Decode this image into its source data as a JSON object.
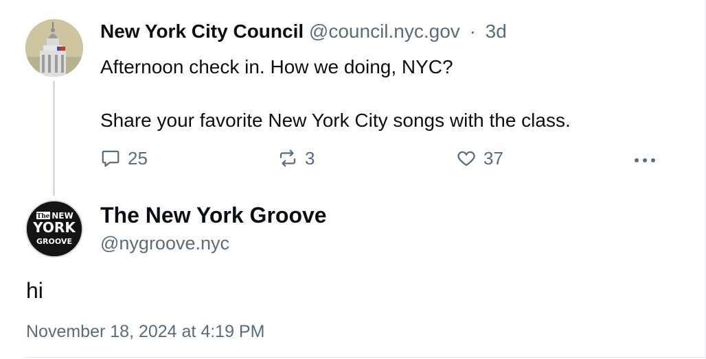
{
  "parent_post": {
    "author_name": "New York City Council",
    "author_handle": "@council.nyc.gov",
    "separator": "·",
    "age": "3d",
    "text_line1": "Afternoon check in. How we doing, NYC?",
    "text_line2": "Share your favorite New York City songs with the class.",
    "avatar_icon": "city-hall-cupola-icon",
    "actions": {
      "reply_count": "25",
      "repost_count": "3",
      "like_count": "37"
    }
  },
  "reply_post": {
    "author_name": "The New York Groove",
    "author_handle": "@nygroove.nyc",
    "avatar_logo_text": [
      "The",
      "NEW",
      "YORK",
      "GROOVE"
    ],
    "text": "hi",
    "timestamp": "November 18, 2024 at 4:19 PM"
  },
  "colors": {
    "text": "#0b0f14",
    "muted": "#5b6b7c",
    "thread_line": "#d4dbe2",
    "divider": "#e3e7eb"
  }
}
